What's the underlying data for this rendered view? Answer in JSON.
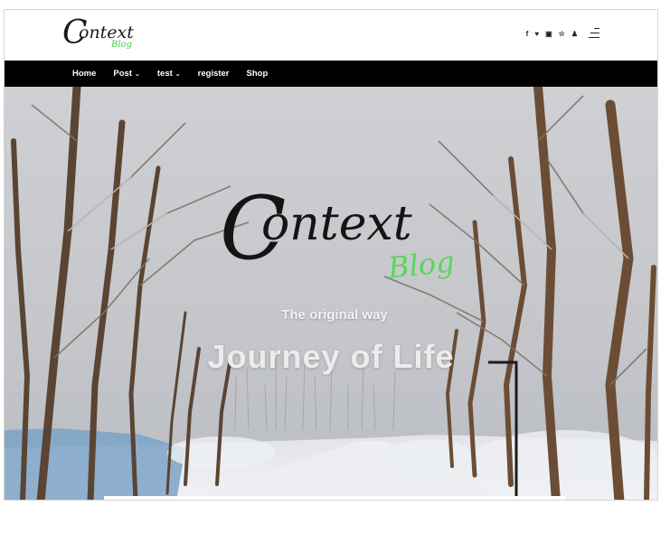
{
  "header": {
    "logo": {
      "cap": "C",
      "word": "ontext",
      "sub": "Blog"
    },
    "social_icons": [
      {
        "name": "facebook-icon",
        "glyph": "f"
      },
      {
        "name": "twitter-icon",
        "glyph": "♥"
      },
      {
        "name": "linkedin-icon",
        "glyph": "▣"
      },
      {
        "name": "star-icon",
        "glyph": "☆"
      },
      {
        "name": "user-icon",
        "glyph": "♟"
      }
    ],
    "menu_icon": "hamburger-menu-icon"
  },
  "nav": {
    "items": [
      {
        "label": "Home",
        "dropdown": false
      },
      {
        "label": "Post",
        "dropdown": true
      },
      {
        "label": "test",
        "dropdown": true
      },
      {
        "label": "register",
        "dropdown": false
      },
      {
        "label": "Shop",
        "dropdown": false
      }
    ]
  },
  "hero": {
    "logo": {
      "cap": "C",
      "word": "ontext",
      "sub": "Blog"
    },
    "subtitle": "The original way",
    "title": "Journey of Life"
  },
  "colors": {
    "accent_green": "#54d957",
    "nav_background": "#000000",
    "text_dark": "#141414"
  }
}
